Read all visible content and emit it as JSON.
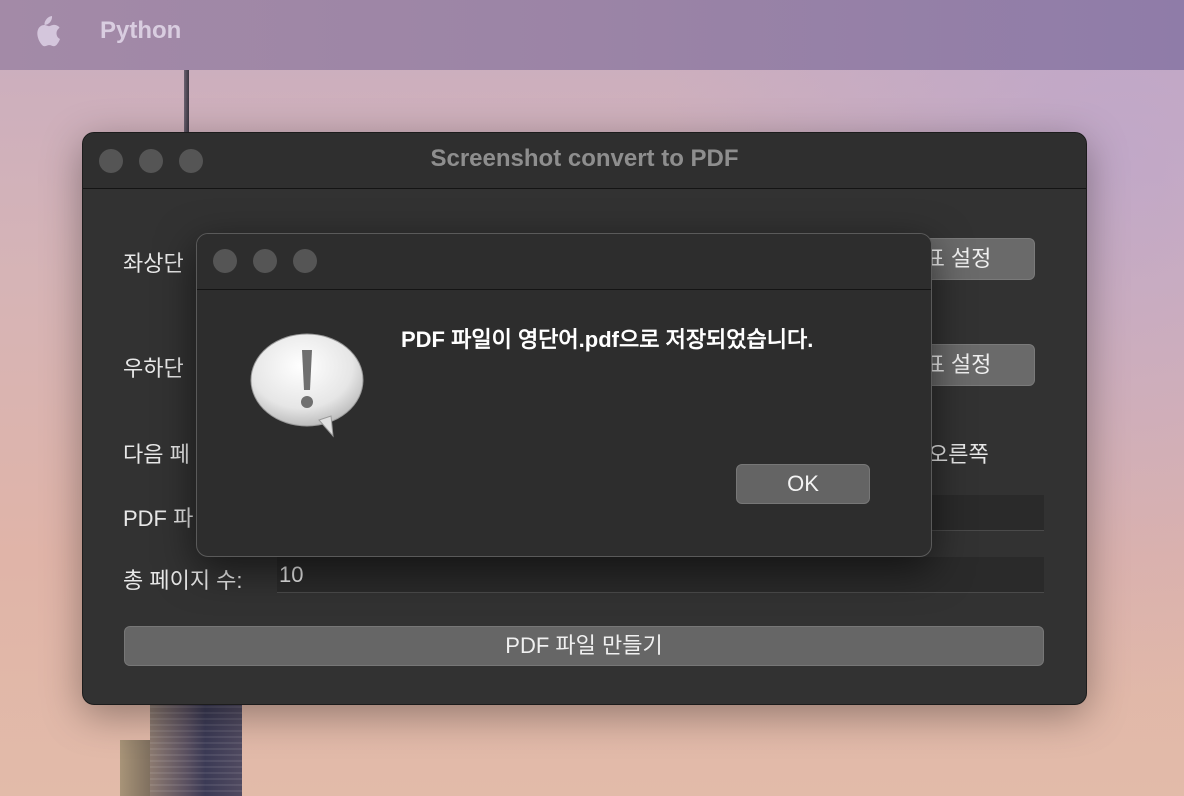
{
  "menubar": {
    "app_name": "Python"
  },
  "window": {
    "title": "Screenshot convert to PDF",
    "top_left_label": "좌상단",
    "bottom_right_label": "우하단",
    "next_page_label": "다음 페",
    "next_page_value": "오른쪽",
    "pdf_label": "PDF 파",
    "pdf_field_value": "",
    "total_pages_label": "총 페이지 수:",
    "total_pages_value": "10",
    "set_top_left_button": "표 설정",
    "set_bottom_right_button": "표 설정",
    "make_pdf_button": "PDF 파일 만들기"
  },
  "alert": {
    "message": "PDF 파일이 영단어.pdf으로 저장되었습니다.",
    "ok_label": "OK",
    "icon": "caution-speech-bubble-icon"
  },
  "colors": {
    "window_bg": "#323232",
    "button_bg": "#666666",
    "traffic_inactive": "#555555"
  }
}
